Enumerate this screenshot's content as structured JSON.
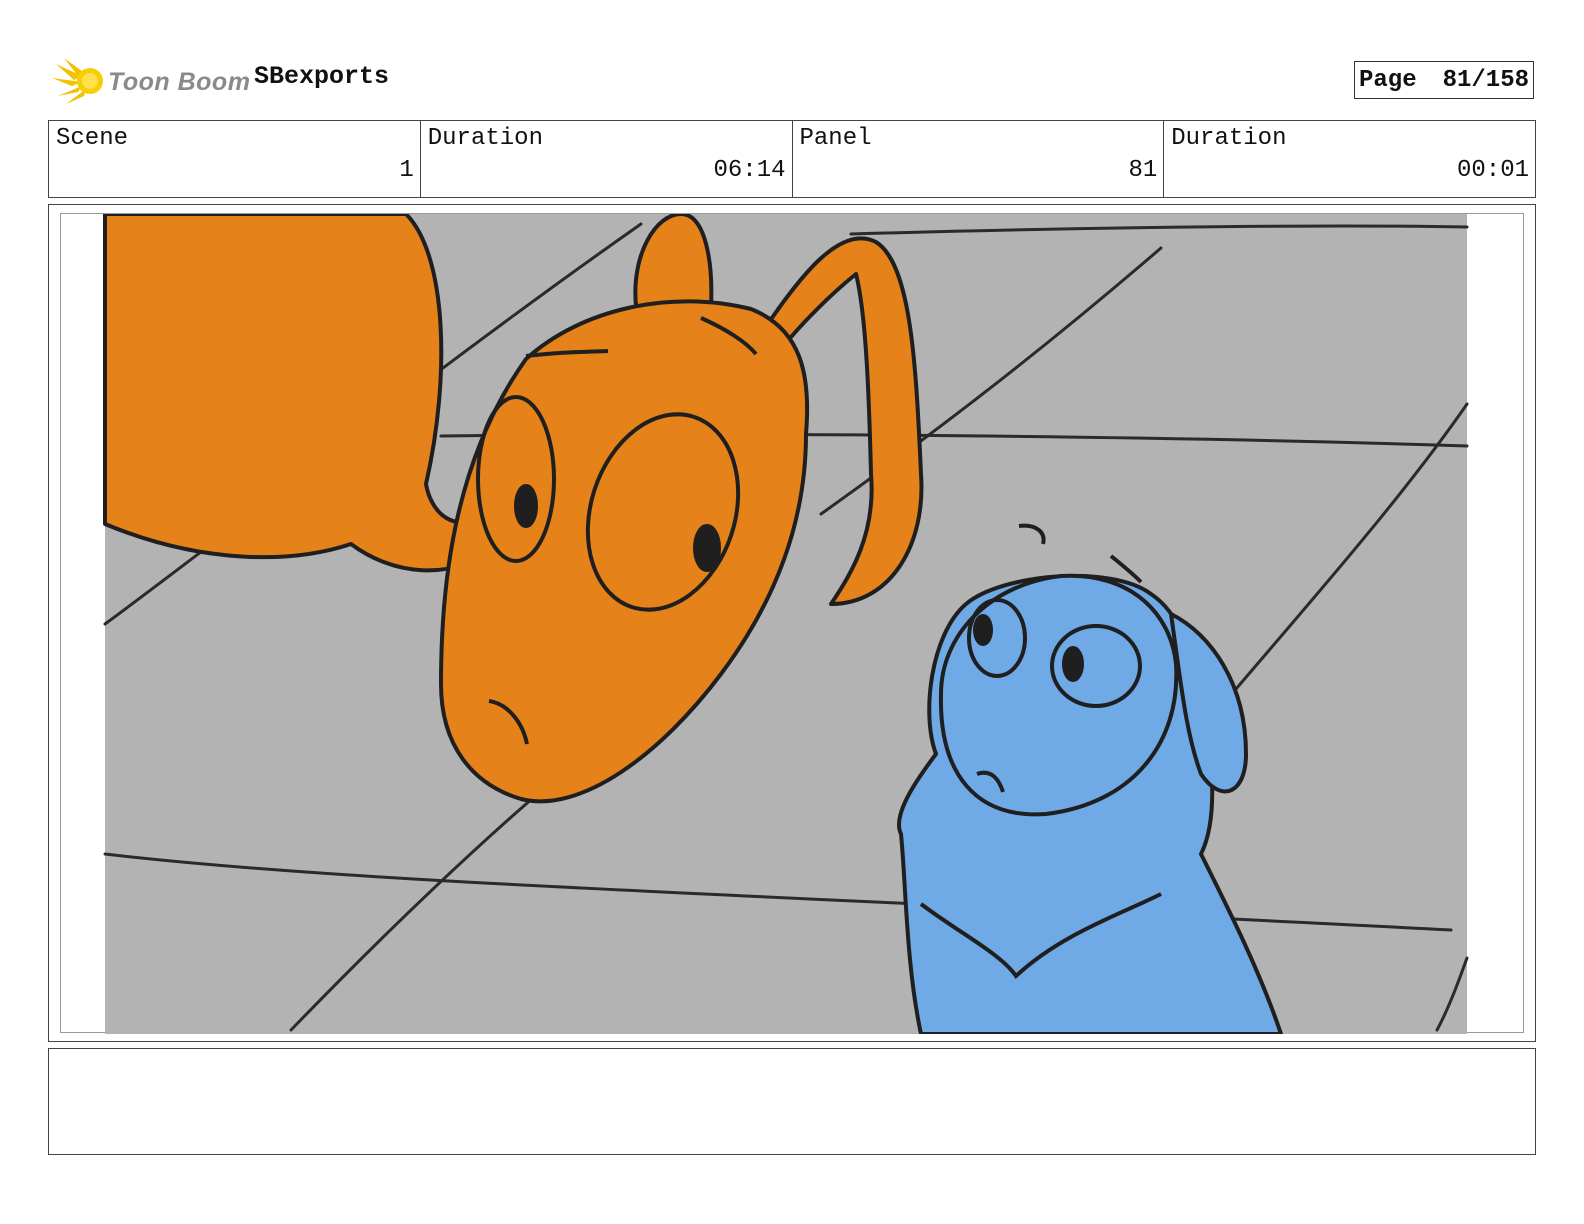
{
  "header": {
    "logo_text": "Toon Boom",
    "project_name": "SBexports",
    "page_label": "Page",
    "page_value": "81/158"
  },
  "info": {
    "scene_label": "Scene",
    "scene_value": "1",
    "scene_duration_label": "Duration",
    "scene_duration_value": "06:14",
    "panel_label": "Panel",
    "panel_value": "81",
    "panel_duration_label": "Duration",
    "panel_duration_value": "00:01"
  },
  "notes": {
    "text": ""
  },
  "colors": {
    "floor": "#b3b3b3",
    "orange_character": "#e5821a",
    "blue_character": "#6fa9e6",
    "ink": "#1f1f1f",
    "logo_star": "#f2c200"
  }
}
